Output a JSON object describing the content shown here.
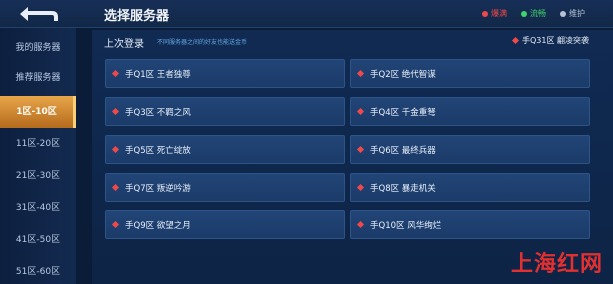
{
  "header": {
    "title": "选择服务器"
  },
  "legend": [
    {
      "label": "爆满",
      "color": "#f0494b"
    },
    {
      "label": "流畅",
      "color": "#3fd36b"
    },
    {
      "label": "维护",
      "color": "#b7c3d4"
    }
  ],
  "sidebar": {
    "items": [
      {
        "label": "我的服务器"
      },
      {
        "label": "推荐服务器"
      },
      {
        "label": "1区-10区"
      },
      {
        "label": "11区-20区"
      },
      {
        "label": "21区-30区"
      },
      {
        "label": "31区-40区"
      },
      {
        "label": "41区-50区"
      },
      {
        "label": "51区-60区"
      }
    ],
    "active": "1区-10区"
  },
  "last_login": {
    "label": "上次登录",
    "note": "不同服务器之间的好友也能送金币",
    "server": "手Q31区 翩凌突袭"
  },
  "servers": [
    {
      "name": "手Q1区 王者独尊"
    },
    {
      "name": "手Q2区 绝代智谋"
    },
    {
      "name": "手Q3区 不羁之风"
    },
    {
      "name": "手Q4区 千金重弩"
    },
    {
      "name": "手Q5区 死亡绽放"
    },
    {
      "name": "手Q6区 最终兵器"
    },
    {
      "name": "手Q7区 叛逆吟游"
    },
    {
      "name": "手Q8区 暴走机关"
    },
    {
      "name": "手Q9区 欲望之月"
    },
    {
      "name": "手Q10区 风华绚烂"
    }
  ],
  "colors": {
    "status_full": "#f0494b",
    "active_tab": "#e8a64a"
  },
  "watermark": "上海红网"
}
